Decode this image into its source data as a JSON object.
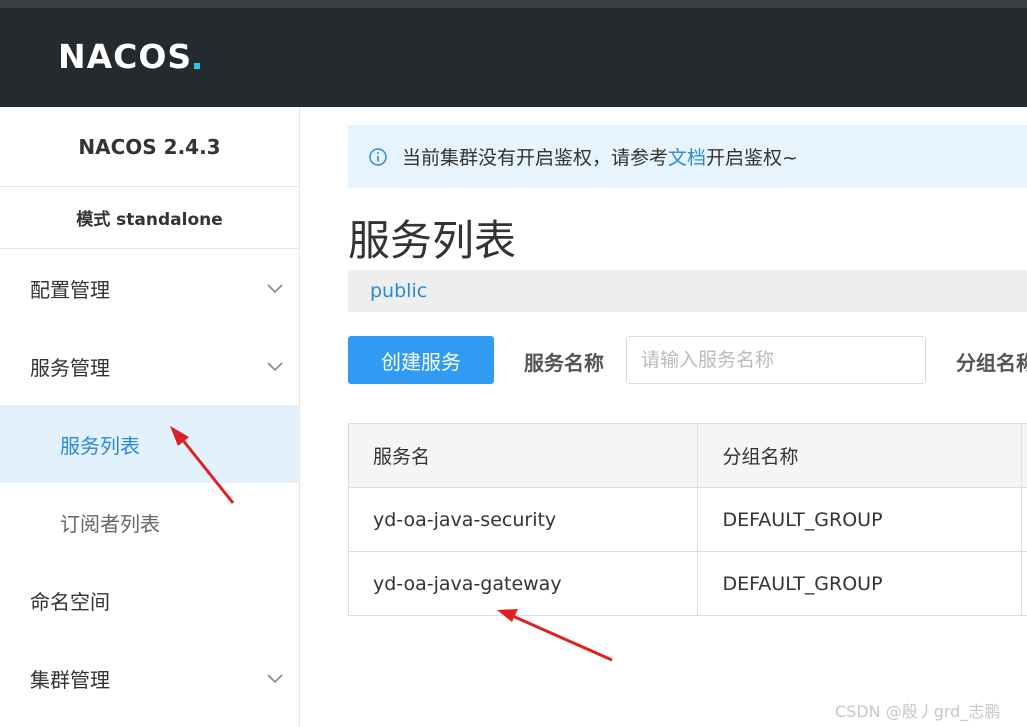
{
  "header": {
    "logo_text": "NACOS",
    "logo_accent": "#29c4e8"
  },
  "sidebar": {
    "version": "NACOS 2.4.3",
    "mode": "模式 standalone",
    "items": [
      {
        "label": "配置管理",
        "icon": "chevron-down-icon"
      },
      {
        "label": "服务管理",
        "icon": "chevron-down-icon"
      },
      {
        "label": "服务列表",
        "active": true
      },
      {
        "label": "订阅者列表"
      },
      {
        "label": "命名空间"
      },
      {
        "label": "集群管理",
        "icon": "chevron-down-icon"
      }
    ]
  },
  "notice": {
    "before": "当前集群没有开启鉴权，请参考",
    "link": "文档",
    "after": "开启鉴权~"
  },
  "page": {
    "title": "服务列表",
    "namespace": "public"
  },
  "toolbar": {
    "create_label": "创建服务",
    "service_name_label": "服务名称",
    "service_name_placeholder": "请输入服务名称",
    "group_name_label": "分组名称"
  },
  "table": {
    "headers": [
      "服务名",
      "分组名称"
    ],
    "rows": [
      [
        "yd-oa-java-security",
        "DEFAULT_GROUP"
      ],
      [
        "yd-oa-java-gateway",
        "DEFAULT_GROUP"
      ]
    ]
  },
  "watermark": "CSDN @殷丿grd_志鹏",
  "colors": {
    "header_bg": "#252a2f",
    "primary": "#2f9bf3",
    "link": "#2b8ad8",
    "annotation_arrow": "#e02020"
  }
}
